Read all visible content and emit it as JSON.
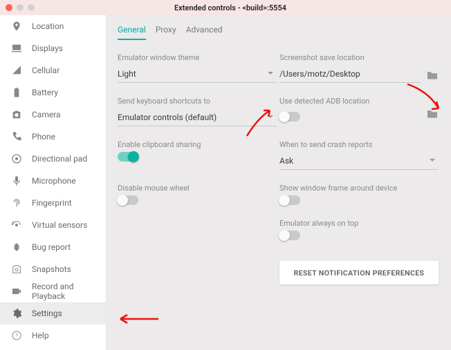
{
  "window": {
    "title": "Extended controls - <build>:5554"
  },
  "sidebar": {
    "items": [
      {
        "label": "Location",
        "icon": "location"
      },
      {
        "label": "Displays",
        "icon": "displays"
      },
      {
        "label": "Cellular",
        "icon": "cellular"
      },
      {
        "label": "Battery",
        "icon": "battery"
      },
      {
        "label": "Camera",
        "icon": "camera"
      },
      {
        "label": "Phone",
        "icon": "phone"
      },
      {
        "label": "Directional pad",
        "icon": "dpad"
      },
      {
        "label": "Microphone",
        "icon": "mic"
      },
      {
        "label": "Fingerprint",
        "icon": "fingerprint"
      },
      {
        "label": "Virtual sensors",
        "icon": "sensors"
      },
      {
        "label": "Bug report",
        "icon": "bug"
      },
      {
        "label": "Snapshots",
        "icon": "snapshot"
      },
      {
        "label": "Record and Playback",
        "icon": "record"
      },
      {
        "label": "Settings",
        "icon": "settings"
      },
      {
        "label": "Help",
        "icon": "help"
      }
    ],
    "selected_index": 13
  },
  "tabs": {
    "items": [
      {
        "label": "General"
      },
      {
        "label": "Proxy"
      },
      {
        "label": "Advanced"
      }
    ],
    "active_index": 0
  },
  "settings": {
    "theme": {
      "label": "Emulator window theme",
      "value": "Light"
    },
    "screenshot": {
      "label": "Screenshot save location",
      "value": "/Users/motz/Desktop"
    },
    "keyboard": {
      "label": "Send keyboard shortcuts to",
      "value": "Emulator controls (default)"
    },
    "adb": {
      "label": "Use detected ADB location",
      "on": false
    },
    "clipboard": {
      "label": "Enable clipboard sharing",
      "on": true
    },
    "crash": {
      "label": "When to send crash reports",
      "value": "Ask"
    },
    "mouse": {
      "label": "Disable mouse wheel",
      "on": false
    },
    "frame": {
      "label": "Show window frame around device",
      "on": false
    },
    "ontop": {
      "label": "Emulator always on top",
      "on": false
    },
    "reset_label": "RESET NOTIFICATION PREFERENCES"
  }
}
